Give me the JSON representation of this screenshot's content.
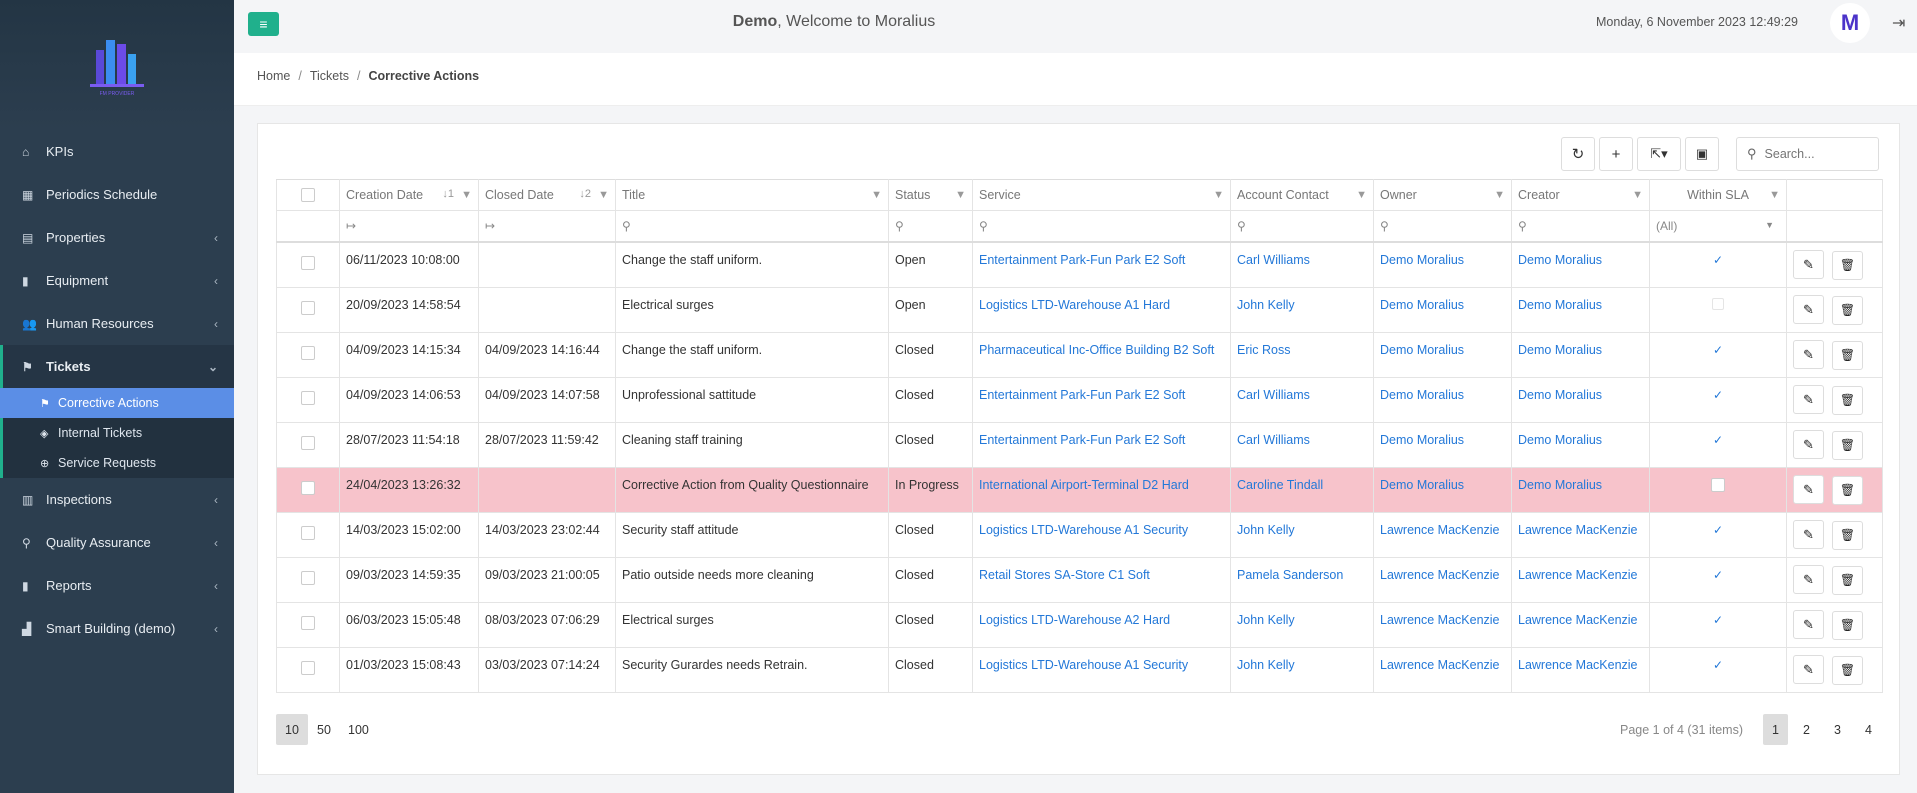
{
  "app": {
    "user": "Demo",
    "welcome_suffix": ", Welcome to Moralius",
    "datetime": "Monday, 6 November 2023 12:49:29",
    "avatar_letter": "M",
    "logo_caption": "FM PROVIDER"
  },
  "sidebar": {
    "items": [
      {
        "label": "KPIs",
        "icon": "home-icon",
        "glyph": "⌂"
      },
      {
        "label": "Periodics Schedule",
        "icon": "calendar-icon",
        "glyph": "▦"
      },
      {
        "label": "Properties",
        "icon": "building-icon",
        "glyph": "▤"
      },
      {
        "label": "Equipment",
        "icon": "book-icon",
        "glyph": "▮"
      },
      {
        "label": "Human Resources",
        "icon": "users-icon",
        "glyph": "👥"
      },
      {
        "label": "Tickets",
        "icon": "ticket-icon",
        "glyph": "⚑"
      }
    ],
    "sub_items": [
      {
        "label": "Corrective Actions",
        "glyph": "⚑"
      },
      {
        "label": "Internal Tickets",
        "glyph": "◈"
      },
      {
        "label": "Service Requests",
        "glyph": "⊕"
      }
    ],
    "items_after": [
      {
        "label": "Inspections",
        "icon": "book-open-icon",
        "glyph": "▥"
      },
      {
        "label": "Quality Assurance",
        "icon": "search-icon",
        "glyph": "⚲"
      },
      {
        "label": "Reports",
        "icon": "book-icon",
        "glyph": "▮"
      },
      {
        "label": "Smart Building (demo)",
        "icon": "bar-chart-icon",
        "glyph": "▟"
      }
    ]
  },
  "breadcrumb": {
    "home": "Home",
    "tickets": "Tickets",
    "current": "Corrective Actions"
  },
  "search": {
    "placeholder": "Search..."
  },
  "columns": [
    "Creation Date",
    "Closed Date",
    "Title",
    "Status",
    "Service",
    "Account Contact",
    "Owner",
    "Creator",
    "Within SLA"
  ],
  "sort_indicators": {
    "creation": "↓1",
    "closed": "↓2"
  },
  "filters": {
    "date_glyph": "↦",
    "search_glyph": "⚲",
    "sla_value": "(All)"
  },
  "rows": [
    {
      "created": "06/11/2023 10:08:00",
      "closed": "",
      "title": "Change the staff uniform.",
      "status": "Open",
      "service": "Entertainment Park-Fun Park E2 Soft",
      "contact": "Carl Williams",
      "owner": "Demo Moralius",
      "creator": "Demo Moralius",
      "sla": "yes"
    },
    {
      "created": "20/09/2023 14:58:54",
      "closed": "",
      "title": "Electrical surges",
      "status": "Open",
      "service": "Logistics LTD-Warehouse A1 Hard",
      "contact": "John Kelly",
      "owner": "Demo Moralius",
      "creator": "Demo Moralius",
      "sla": "disabled"
    },
    {
      "created": "04/09/2023 14:15:34",
      "closed": "04/09/2023 14:16:44",
      "title": "Change the staff uniform.",
      "status": "Closed",
      "service": "Pharmaceutical Inc-Office Building B2 Soft",
      "contact": "Eric Ross",
      "owner": "Demo Moralius",
      "creator": "Demo Moralius",
      "sla": "yes"
    },
    {
      "created": "04/09/2023 14:06:53",
      "closed": "04/09/2023 14:07:58",
      "title": "Unprofessional sattitude",
      "status": "Closed",
      "service": "Entertainment Park-Fun Park E2 Soft",
      "contact": "Carl Williams",
      "owner": "Demo Moralius",
      "creator": "Demo Moralius",
      "sla": "yes"
    },
    {
      "created": "28/07/2023 11:54:18",
      "closed": "28/07/2023 11:59:42",
      "title": "Cleaning staff training",
      "status": "Closed",
      "service": "Entertainment Park-Fun Park E2 Soft",
      "contact": "Carl Williams",
      "owner": "Demo Moralius",
      "creator": "Demo Moralius",
      "sla": "yes"
    },
    {
      "created": "24/04/2023 13:26:32",
      "closed": "",
      "title": "Corrective Action from Quality Questionnaire",
      "status": "In Progress",
      "service": "International Airport-Terminal D2 Hard",
      "contact": "Caroline Tindall",
      "owner": "Demo Moralius",
      "creator": "Demo Moralius",
      "sla": "no",
      "highlight": true
    },
    {
      "created": "14/03/2023 15:02:00",
      "closed": "14/03/2023 23:02:44",
      "title": "Security staff attitude",
      "status": "Closed",
      "service": "Logistics LTD-Warehouse A1 Security",
      "contact": "John Kelly",
      "owner": "Lawrence MacKenzie",
      "creator": "Lawrence MacKenzie",
      "sla": "yes"
    },
    {
      "created": "09/03/2023 14:59:35",
      "closed": "09/03/2023 21:00:05",
      "title": "Patio outside needs more cleaning",
      "status": "Closed",
      "service": "Retail Stores SA-Store C1 Soft",
      "contact": "Pamela Sanderson",
      "owner": "Lawrence MacKenzie",
      "creator": "Lawrence MacKenzie",
      "sla": "yes"
    },
    {
      "created": "06/03/2023 15:05:48",
      "closed": "08/03/2023 07:06:29",
      "title": "Electrical surges",
      "status": "Closed",
      "service": "Logistics LTD-Warehouse A2 Hard",
      "contact": "John Kelly",
      "owner": "Lawrence MacKenzie",
      "creator": "Lawrence MacKenzie",
      "sla": "yes"
    },
    {
      "created": "01/03/2023 15:08:43",
      "closed": "03/03/2023 07:14:24",
      "title": "Security Gurardes needs Retrain.",
      "status": "Closed",
      "service": "Logistics LTD-Warehouse A1 Security",
      "contact": "John Kelly",
      "owner": "Lawrence MacKenzie",
      "creator": "Lawrence MacKenzie",
      "sla": "yes"
    }
  ],
  "pager": {
    "sizes": [
      "10",
      "50",
      "100"
    ],
    "active_size": "10",
    "info": "Page 1 of 4 (31 items)",
    "pages": [
      "1",
      "2",
      "3",
      "4"
    ],
    "active_page": "1"
  },
  "colors": {
    "accent": "#20b08c",
    "sidebar": "#2c3e4f",
    "active_sub": "#5b8ee6",
    "link": "#2378d8",
    "highlight_row": "#f7c3cb"
  }
}
